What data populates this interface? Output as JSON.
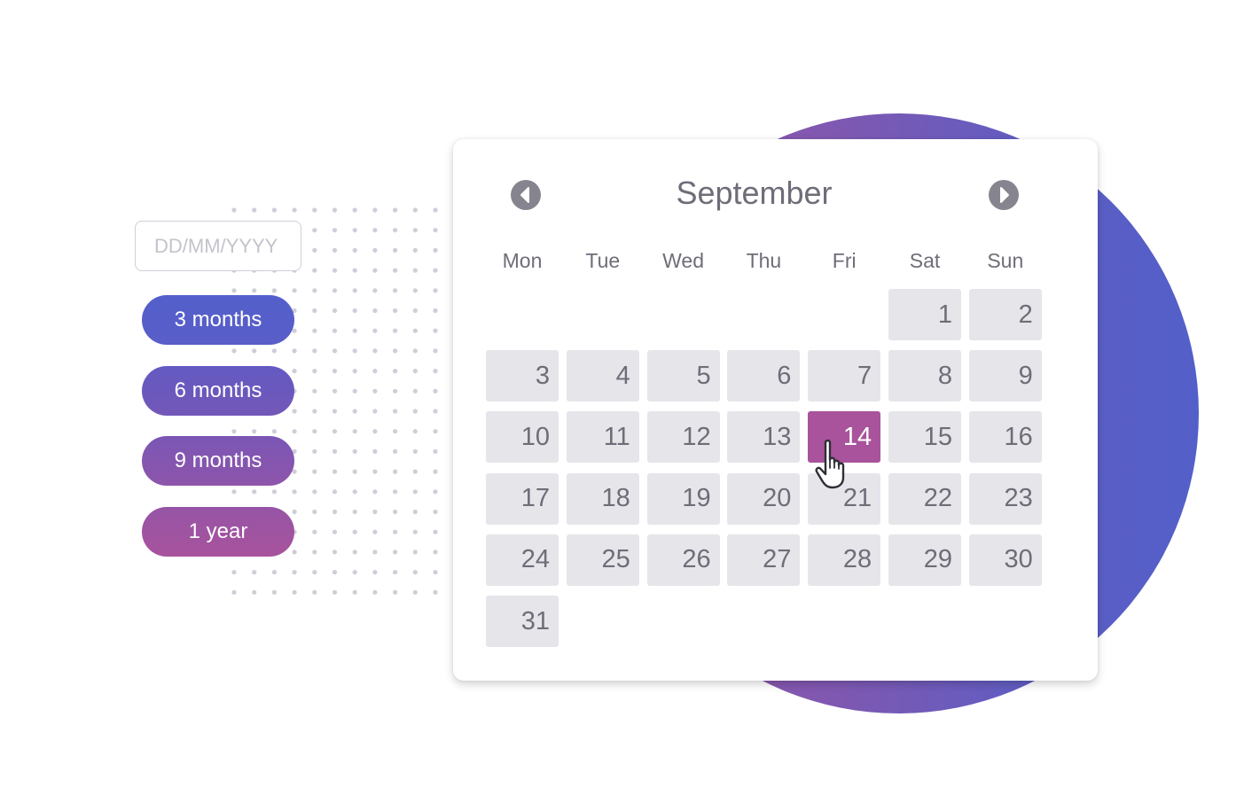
{
  "background": {
    "circle_gradient": [
      "#9a55a8",
      "#535fc9"
    ],
    "dot_color": "#cfcdd8"
  },
  "date_input": {
    "value": "",
    "placeholder": "DD/MM/YYYY"
  },
  "duration_options": [
    {
      "label": "3 months"
    },
    {
      "label": "6 months"
    },
    {
      "label": "9 months"
    },
    {
      "label": "1 year"
    }
  ],
  "calendar": {
    "month": "September",
    "prev_icon": "chevron-left-circle-icon",
    "next_icon": "chevron-right-circle-icon",
    "weekdays": [
      "Mon",
      "Tue",
      "Wed",
      "Thu",
      "Fri",
      "Sat",
      "Sun"
    ],
    "first_weekday_index": 5,
    "days_in_month": 31,
    "selected_day": 14,
    "selected_color": "#a8539c",
    "cell_color": "#e6e5ea",
    "text_color": "#6e6d78",
    "cursor_icon": "hand-pointer-icon"
  }
}
